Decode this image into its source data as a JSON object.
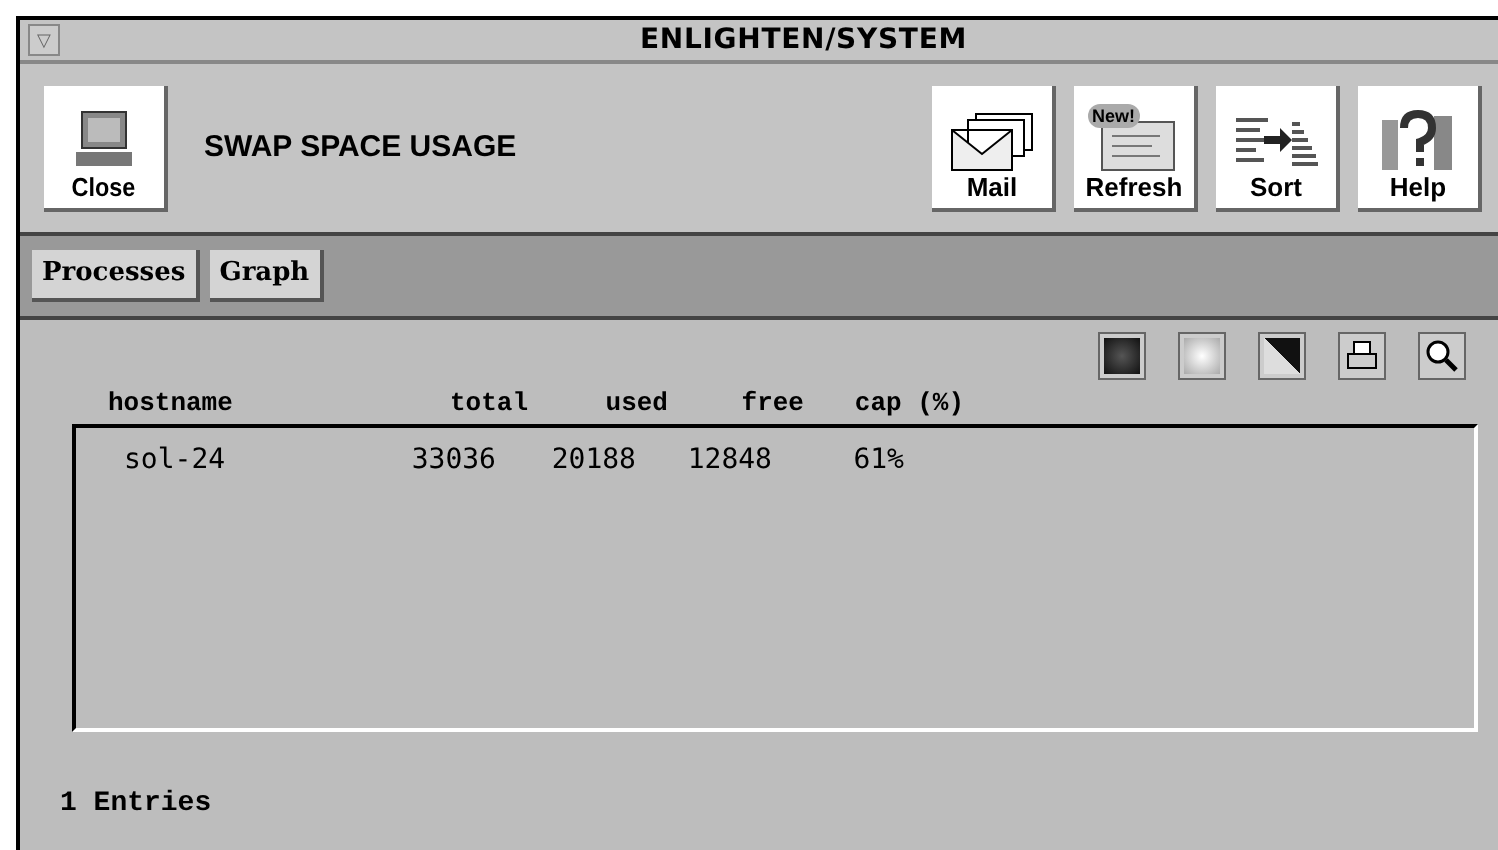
{
  "window": {
    "title": "ENLIGHTEN/SYSTEM",
    "menu_glyph": "▽"
  },
  "toolbar": {
    "close_label": "Close",
    "heading": "SWAP SPACE USAGE",
    "buttons": [
      {
        "kind": "mail",
        "label": "Mail"
      },
      {
        "kind": "refresh",
        "label": "Refresh",
        "badge": "New!"
      },
      {
        "kind": "sort",
        "label": "Sort"
      },
      {
        "kind": "help",
        "label": "Help"
      }
    ]
  },
  "tabs": [
    "Processes",
    "Graph"
  ],
  "tools": [
    {
      "kind": "dark"
    },
    {
      "kind": "light"
    },
    {
      "kind": "contrast"
    },
    {
      "kind": "print"
    },
    {
      "kind": "search"
    }
  ],
  "table": {
    "columns": [
      "hostname",
      "total",
      "used",
      "free",
      "cap (%)"
    ],
    "rows": [
      [
        "sol-24",
        "33036",
        "20188",
        "12848",
        "61%"
      ]
    ]
  },
  "status_bar": "1 Entries"
}
